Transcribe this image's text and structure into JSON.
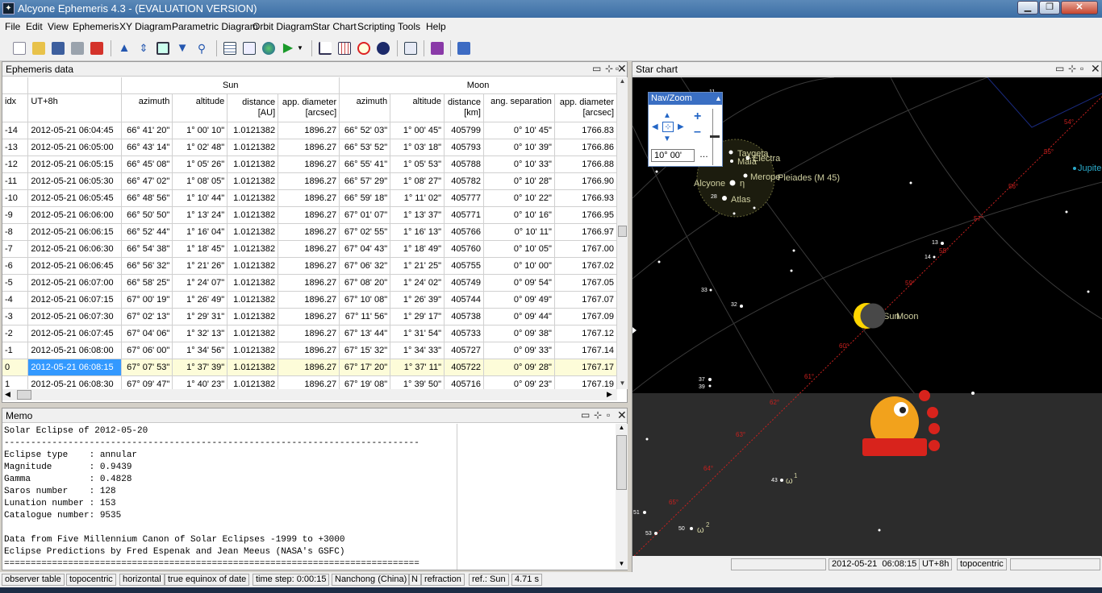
{
  "window": {
    "title": "Alcyone Ephemeris 4.3 - (EVALUATION VERSION)",
    "icon": "star-app-icon"
  },
  "menu": [
    "File",
    "Edit",
    "View",
    "Ephemeris",
    "XY Diagram",
    "Parametric Diagram",
    "Orbit Diagram",
    "Star Chart",
    "Scripting",
    "Tools",
    "Help"
  ],
  "toolbar_icons": [
    "new-icon",
    "open-icon",
    "save-icon",
    "print-icon",
    "export-icon",
    "up-arrow-icon",
    "fit-vertical-icon",
    "window-icon",
    "down-arrow-icon",
    "search-icon",
    "table-icon",
    "checklist-icon",
    "globe-icon",
    "play-icon",
    "dropdown-icon",
    "xy-chart-icon",
    "grid-chart-icon",
    "orbit-icon",
    "star-chart-icon",
    "diagram-icon",
    "book-icon",
    "plugin-icon"
  ],
  "ephemeris": {
    "title": "Ephemeris data",
    "group_sun": "Sun",
    "group_moon": "Moon",
    "columns": [
      "idx",
      "UT+8h",
      "azimuth",
      "altitude",
      "distance\n[AU]",
      "app. diameter\n[arcsec]",
      "azimuth",
      "altitude",
      "distance\n[km]",
      "ang. separation",
      "app. diameter\n[arcsec]"
    ],
    "rows": [
      [
        "-14",
        "2012-05-21 06:04:45",
        "66° 41' 20\"",
        "1° 00' 10\"",
        "1.0121382",
        "1896.27",
        "66° 52' 03\"",
        "1° 00' 45\"",
        "405799",
        "0° 10' 45\"",
        "1766.83"
      ],
      [
        "-13",
        "2012-05-21 06:05:00",
        "66° 43' 14\"",
        "1° 02' 48\"",
        "1.0121382",
        "1896.27",
        "66° 53' 52\"",
        "1° 03' 18\"",
        "405793",
        "0° 10' 39\"",
        "1766.86"
      ],
      [
        "-12",
        "2012-05-21 06:05:15",
        "66° 45' 08\"",
        "1° 05' 26\"",
        "1.0121382",
        "1896.27",
        "66° 55' 41\"",
        "1° 05' 53\"",
        "405788",
        "0° 10' 33\"",
        "1766.88"
      ],
      [
        "-11",
        "2012-05-21 06:05:30",
        "66° 47' 02\"",
        "1° 08' 05\"",
        "1.0121382",
        "1896.27",
        "66° 57' 29\"",
        "1° 08' 27\"",
        "405782",
        "0° 10' 28\"",
        "1766.90"
      ],
      [
        "-10",
        "2012-05-21 06:05:45",
        "66° 48' 56\"",
        "1° 10' 44\"",
        "1.0121382",
        "1896.27",
        "66° 59' 18\"",
        "1° 11' 02\"",
        "405777",
        "0° 10' 22\"",
        "1766.93"
      ],
      [
        "-9",
        "2012-05-21 06:06:00",
        "66° 50' 50\"",
        "1° 13' 24\"",
        "1.0121382",
        "1896.27",
        "67° 01' 07\"",
        "1° 13' 37\"",
        "405771",
        "0° 10' 16\"",
        "1766.95"
      ],
      [
        "-8",
        "2012-05-21 06:06:15",
        "66° 52' 44\"",
        "1° 16' 04\"",
        "1.0121382",
        "1896.27",
        "67° 02' 55\"",
        "1° 16' 13\"",
        "405766",
        "0° 10' 11\"",
        "1766.97"
      ],
      [
        "-7",
        "2012-05-21 06:06:30",
        "66° 54' 38\"",
        "1° 18' 45\"",
        "1.0121382",
        "1896.27",
        "67° 04' 43\"",
        "1° 18' 49\"",
        "405760",
        "0° 10' 05\"",
        "1767.00"
      ],
      [
        "-6",
        "2012-05-21 06:06:45",
        "66° 56' 32\"",
        "1° 21' 26\"",
        "1.0121382",
        "1896.27",
        "67° 06' 32\"",
        "1° 21' 25\"",
        "405755",
        "0° 10' 00\"",
        "1767.02"
      ],
      [
        "-5",
        "2012-05-21 06:07:00",
        "66° 58' 25\"",
        "1° 24' 07\"",
        "1.0121382",
        "1896.27",
        "67° 08' 20\"",
        "1° 24' 02\"",
        "405749",
        "0° 09' 54\"",
        "1767.05"
      ],
      [
        "-4",
        "2012-05-21 06:07:15",
        "67° 00' 19\"",
        "1° 26' 49\"",
        "1.0121382",
        "1896.27",
        "67° 10' 08\"",
        "1° 26' 39\"",
        "405744",
        "0° 09' 49\"",
        "1767.07"
      ],
      [
        "-3",
        "2012-05-21 06:07:30",
        "67° 02' 13\"",
        "1° 29' 31\"",
        "1.0121382",
        "1896.27",
        "67° 11' 56\"",
        "1° 29' 17\"",
        "405738",
        "0° 09' 44\"",
        "1767.09"
      ],
      [
        "-2",
        "2012-05-21 06:07:45",
        "67° 04' 06\"",
        "1° 32' 13\"",
        "1.0121382",
        "1896.27",
        "67° 13' 44\"",
        "1° 31' 54\"",
        "405733",
        "0° 09' 38\"",
        "1767.12"
      ],
      [
        "-1",
        "2012-05-21 06:08:00",
        "67° 06' 00\"",
        "1° 34' 56\"",
        "1.0121382",
        "1896.27",
        "67° 15' 32\"",
        "1° 34' 33\"",
        "405727",
        "0° 09' 33\"",
        "1767.14"
      ],
      [
        "0",
        "2012-05-21 06:08:15",
        "67° 07' 53\"",
        "1° 37' 39\"",
        "1.0121382",
        "1896.27",
        "67° 17' 20\"",
        "1° 37' 11\"",
        "405722",
        "0° 09' 28\"",
        "1767.17"
      ],
      [
        "1",
        "2012-05-21 06:08:30",
        "67° 09' 47\"",
        "1° 40' 23\"",
        "1.0121382",
        "1896.27",
        "67° 19' 08\"",
        "1° 39' 50\"",
        "405716",
        "0° 09' 23\"",
        "1767.19"
      ]
    ]
  },
  "memo": {
    "title": "Memo",
    "lines": [
      "Solar Eclipse of 2012-05-20",
      "------------------------------------------------------------------------------",
      "Eclipse type    : annular",
      "Magnitude       : 0.9439",
      "Gamma           : 0.4828",
      "Saros number    : 128",
      "Lunation number : 153",
      "Catalogue number: 9535",
      "",
      "Data from Five Millennium Canon of Solar Eclipses -1999 to +3000",
      "Eclipse Predictions by Fred Espenak and Jean Meeus (NASA's GSFC)",
      "=============================================================================="
    ]
  },
  "starchart": {
    "title": "Star chart",
    "navzoom_title": "Nav/Zoom",
    "fov_value": "10° 00'",
    "labels": {
      "taygeta": "Taygeta",
      "maia": "Maia",
      "electra": "Electra",
      "merope": "Merope",
      "pleiades": "Pleiades (M 45)",
      "alcyone": "Alcyone",
      "eta": "η",
      "atlas": "Atlas",
      "jupiter": "Jupite",
      "sun": "Sun",
      "moon": "Moon",
      "omega1": "ω",
      "omega1_sup": "1",
      "omega2": "ω",
      "omega2_sup": "2"
    },
    "star_numbers": [
      "11",
      "13",
      "14",
      "28",
      "32",
      "33",
      "37",
      "39",
      "43",
      "50",
      "51",
      "53"
    ],
    "ecliptic_ticks": [
      "54°",
      "55°",
      "56°",
      "57°",
      "58°",
      "59°",
      "60°",
      "61°",
      "62°",
      "63°",
      "64°",
      "65°"
    ],
    "status_datetime": "2012-05-21  06:08:15",
    "status_tz": "UT+8h",
    "status_mode": "topocentric",
    "colors": {
      "sky": "#000000",
      "ground": "#2c2c2c",
      "ecliptic": "#c8201e",
      "label": "#cfcfa0",
      "jupiter": "#2aa9c9"
    }
  },
  "statusbar": [
    "observer table",
    "topocentric",
    "horizontal",
    "true equinox of date",
    "time step: 0:00:15",
    "Nanchong (China)",
    "N",
    "refraction",
    "ref.: Sun",
    "4.71 s"
  ]
}
